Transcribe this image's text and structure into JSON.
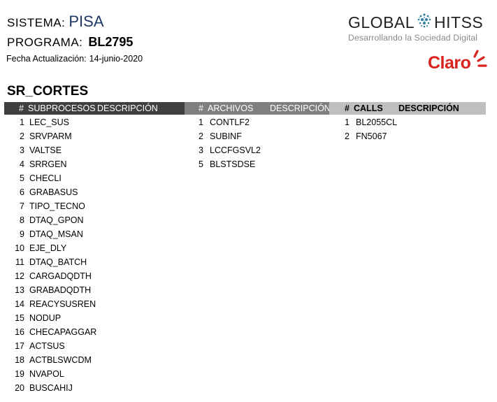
{
  "header": {
    "sistema_label": "SISTEMA:",
    "sistema_value": "PISA",
    "programa_label": "PROGRAMA:",
    "programa_value": "BL2795",
    "fecha_label": "Fecha Actualización:",
    "fecha_value": "14-junio-2020"
  },
  "brand": {
    "name_left": "GLOBAL",
    "name_right": "HITSS",
    "tagline": "Desarrollando la Sociedad Digital",
    "claro": "Claro"
  },
  "section_title": "SR_CORTES",
  "table_headers": {
    "subprocesos": {
      "num": "#",
      "name": "SUBPROCESOS",
      "desc": "DESCRIPCIÓN"
    },
    "archivos": {
      "num": "#",
      "name": "ARCHIVOS",
      "desc": "DESCRIPCIÓN"
    },
    "calls": {
      "num": "#",
      "name": "CALLS",
      "desc": "DESCRIPCIÓN"
    }
  },
  "subprocesos": [
    {
      "num": "1",
      "name": "LEC_SUS"
    },
    {
      "num": "2",
      "name": "SRVPARM"
    },
    {
      "num": "3",
      "name": "VALTSE"
    },
    {
      "num": "4",
      "name": "SRRGEN"
    },
    {
      "num": "5",
      "name": "CHECLI"
    },
    {
      "num": "6",
      "name": "GRABASUS"
    },
    {
      "num": "7",
      "name": "TIPO_TECNO"
    },
    {
      "num": "8",
      "name": "DTAQ_GPON"
    },
    {
      "num": "9",
      "name": "DTAQ_MSAN"
    },
    {
      "num": "10",
      "name": "EJE_DLY"
    },
    {
      "num": "11",
      "name": "DTAQ_BATCH"
    },
    {
      "num": "12",
      "name": "CARGADQDTH"
    },
    {
      "num": "13",
      "name": "GRABADQDTH"
    },
    {
      "num": "14",
      "name": "REACYSUSREN"
    },
    {
      "num": "15",
      "name": "NODUP"
    },
    {
      "num": "16",
      "name": "CHECAPAGGAR"
    },
    {
      "num": "17",
      "name": "ACTSUS"
    },
    {
      "num": "18",
      "name": "ACTBLSWCDM"
    },
    {
      "num": "19",
      "name": "NVAPOL"
    },
    {
      "num": "20",
      "name": "BUSCAHIJ"
    }
  ],
  "archivos": [
    {
      "num": "1",
      "name": "CONTLF2"
    },
    {
      "num": "2",
      "name": "SUBINF"
    },
    {
      "num": "3",
      "name": "LCCFGSVL2"
    },
    {
      "num": "5",
      "name": "BLSTSDSE"
    }
  ],
  "calls": [
    {
      "num": "1",
      "name": "BL2055CL"
    },
    {
      "num": "2",
      "name": "FN5067"
    }
  ],
  "colors": {
    "header_dark": "#404040",
    "header_mid": "#7f7f7f",
    "header_light": "#bfbfbf",
    "claro_red": "#d8231f",
    "pisa_blue": "#1f3864"
  },
  "icons": [
    "globe-icon",
    "claro-rays-icon"
  ]
}
